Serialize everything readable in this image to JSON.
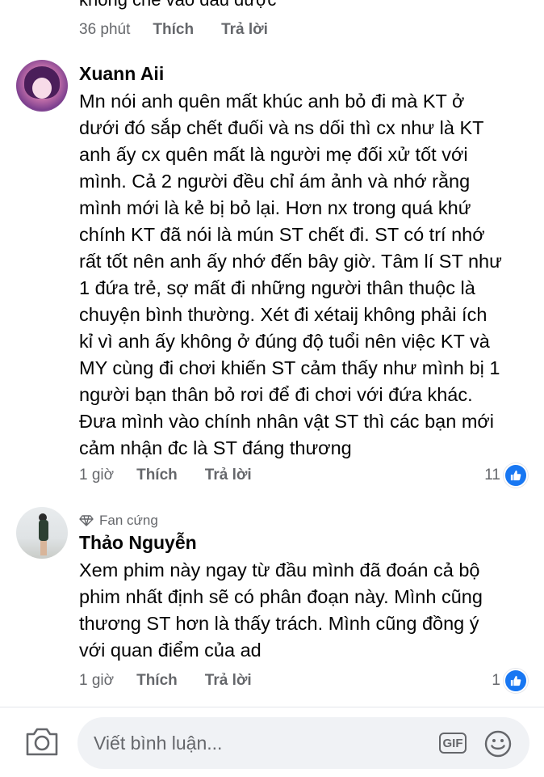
{
  "previous_comment": {
    "text_fragment": "không chế vào đâu được",
    "time": "36 phút",
    "like_label": "Thích",
    "reply_label": "Trả lời"
  },
  "comments": [
    {
      "author": "Xuann Aii",
      "badge": "",
      "lines": [
        "Mn nói anh quên mất khúc anh bỏ đi mà KT ở",
        "dưới đó sắp chết đuối và ns dối thì cx như là KT",
        "anh ấy cx quên mất là người mẹ đối xử tốt với",
        "mình. Cả 2 người đều chỉ ám ảnh và nhớ rằng",
        "mình mới là kẻ bị bỏ lại. Hơn nx trong quá khứ",
        "chính KT đã nói là mún ST chết đi. ST có trí nhớ",
        "rất tốt nên anh ấy nhớ đến bây giờ. Tâm lí ST như",
        "1 đứa trẻ, sợ mất đi những người thân thuộc là",
        "chuyện bình thường. Xét đi xétaij không phải ích",
        "kỉ vì anh ấy không ở đúng độ tuổi nên việc KT và",
        "MY cùng đi chơi khiến ST cảm thấy như mình bị 1",
        "người bạn thân bỏ rơi để đi chơi với đứa khác.",
        "Đưa mình vào chính nhân vật ST thì các bạn mới",
        "cảm nhận đc là ST đáng thương"
      ],
      "time": "1 giờ",
      "like_label": "Thích",
      "reply_label": "Trả lời",
      "reaction_count": "11"
    },
    {
      "author": "Thảo Nguyễn",
      "badge": "Fan cứng",
      "lines": [
        "Xem phim này ngay từ đầu mình đã đoán cả bộ",
        "phim nhất định sẽ có phân đoạn này. Mình cũng",
        "thương ST hơn là thấy trách. Mình cũng đồng ý",
        "với quan điểm của ad"
      ],
      "time": "1 giờ",
      "like_label": "Thích",
      "reply_label": "Trả lời",
      "reaction_count": "1"
    }
  ],
  "composer": {
    "placeholder": "Viết bình luận...",
    "gif_label": "GIF"
  },
  "icons": {
    "camera": "camera-icon",
    "gif": "gif-icon",
    "emoji": "emoji-icon",
    "like": "like-thumb-icon",
    "badge": "diamond-icon"
  },
  "colors": {
    "like_blue": "#1877f2",
    "meta_gray": "#65676b",
    "input_bg": "#f0f2f5"
  }
}
